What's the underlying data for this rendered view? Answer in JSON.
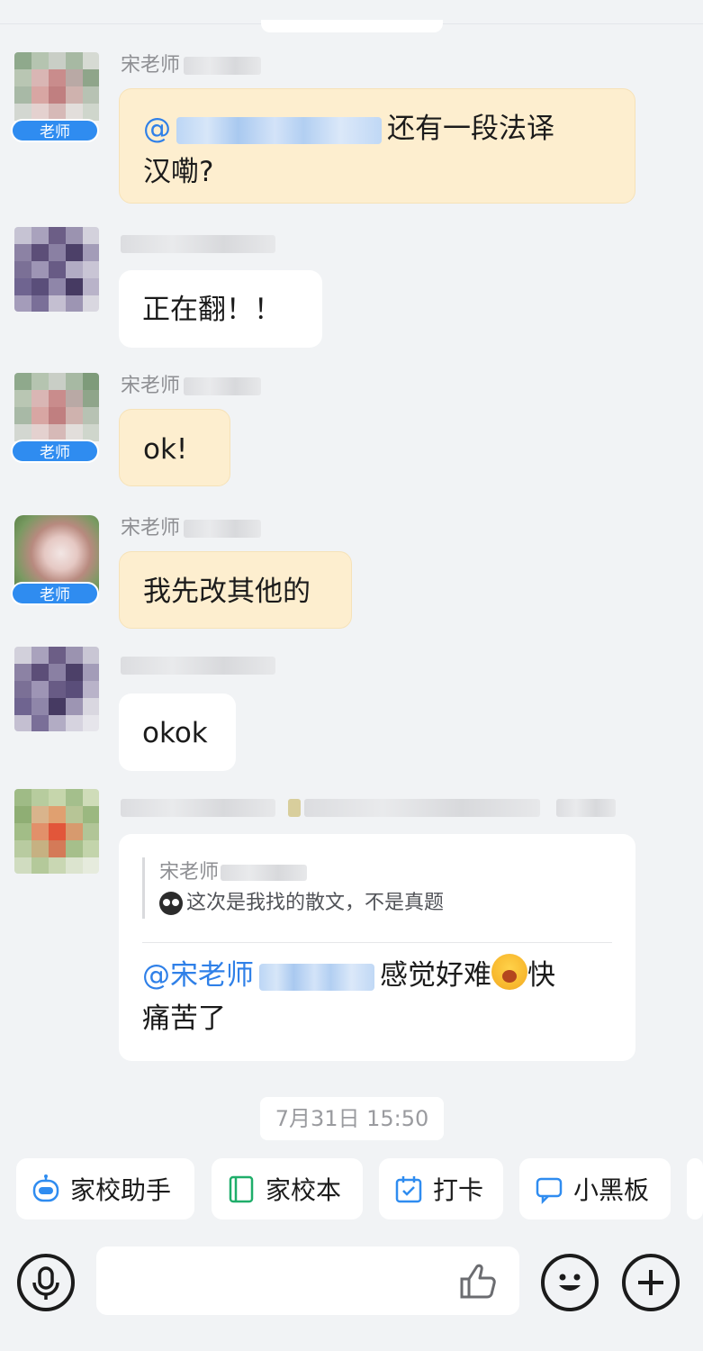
{
  "messages": [
    {
      "sender": "宋老师",
      "role_badge": "老师",
      "mention_at": "@",
      "text_line1": "还有一段法译",
      "text_line2": "汉嘞?"
    },
    {
      "text": "正在翻！！"
    },
    {
      "sender": "宋老师",
      "role_badge": "老师",
      "text": "ok!"
    },
    {
      "sender": "宋老师",
      "role_badge": "老师",
      "text": "我先改其他的"
    },
    {
      "text": "okok"
    },
    {
      "quote_name": "宋老师",
      "quote_text": "这次是我找的散文，不是真题",
      "mention": "@宋老师",
      "text_part1": "感觉好难",
      "text_part2": "快",
      "text_line2": "痛苦了"
    }
  ],
  "timestamp": "7月31日 15:50",
  "quick_actions": [
    {
      "label": "家校助手",
      "icon": "robot-icon",
      "color": "#2f8cf0"
    },
    {
      "label": "家校本",
      "icon": "notebook-icon",
      "color": "#1fae6a"
    },
    {
      "label": "打卡",
      "icon": "calendar-check-icon",
      "color": "#2f8cf0"
    },
    {
      "label": "小黑板",
      "icon": "chat-board-icon",
      "color": "#2f8cf0"
    }
  ],
  "colors": {
    "teacher_bubble": "#fdeecf",
    "teacher_badge": "#2f8cf0",
    "mention": "#2f80e8",
    "background": "#f1f3f5"
  }
}
